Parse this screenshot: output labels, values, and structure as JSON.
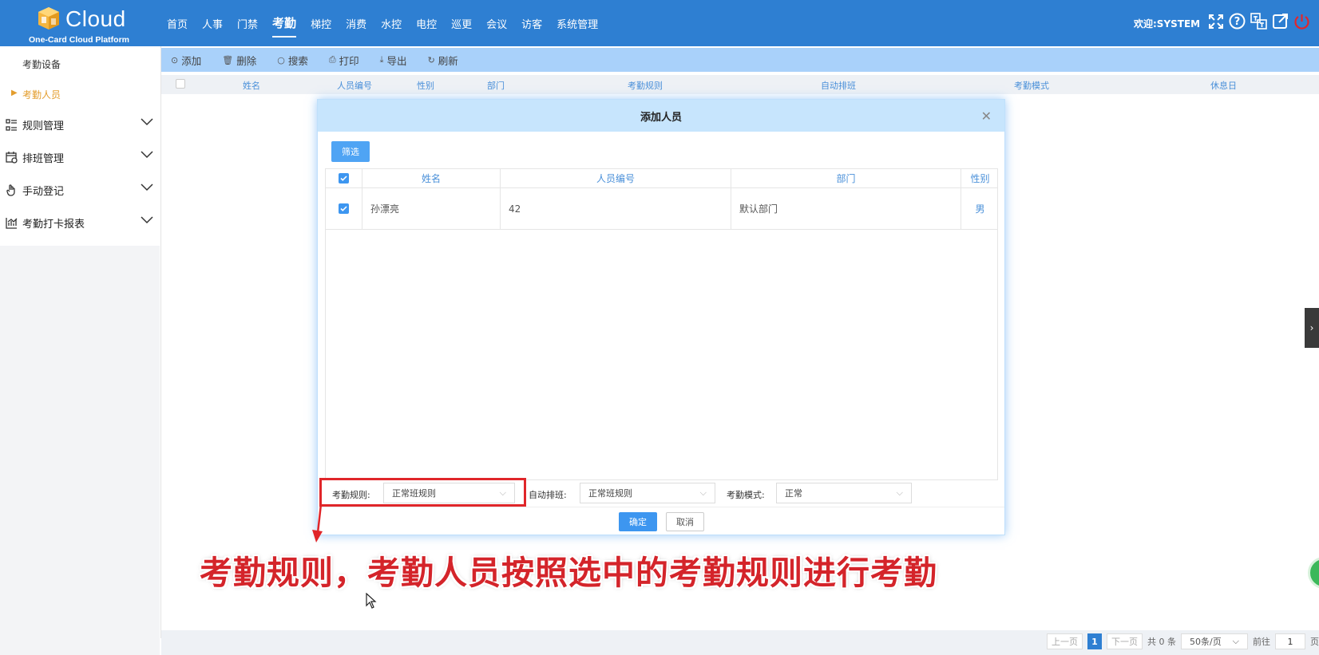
{
  "header": {
    "logo_text": "Cloud",
    "logo_sub": "One-Card Cloud Platform",
    "nav": [
      "首页",
      "人事",
      "门禁",
      "考勤",
      "梯控",
      "消费",
      "水控",
      "电控",
      "巡更",
      "会议",
      "访客",
      "系统管理"
    ],
    "active_nav": "考勤",
    "welcome": "欢迎:SYSTEM",
    "icons": [
      "fullscreen-icon",
      "help-icon",
      "language-icon",
      "external-link-icon",
      "power-icon"
    ]
  },
  "sidebar": {
    "sub_items": [
      {
        "label": "考勤设备"
      },
      {
        "label": "考勤人员",
        "active": true
      }
    ],
    "groups": [
      {
        "label": "规则管理",
        "icon": "list-icon"
      },
      {
        "label": "排班管理",
        "icon": "calendar-icon"
      },
      {
        "label": "手动登记",
        "icon": "hand-icon"
      },
      {
        "label": "考勤打卡报表",
        "icon": "chart-icon"
      }
    ]
  },
  "toolbar": {
    "add": "添加",
    "delete": "删除",
    "search": "搜索",
    "print": "打印",
    "export": "导出",
    "refresh": "刷新"
  },
  "main_table": {
    "columns": [
      "姓名",
      "人员编号",
      "性别",
      "部门",
      "考勤规则",
      "自动排班",
      "考勤模式",
      "休息日"
    ]
  },
  "pager": {
    "prev": "上一页",
    "page": "1",
    "next": "下一页",
    "total": "共 0 条",
    "size": "50条/页",
    "goto": "前往",
    "goto_value": "1",
    "page_unit": "页"
  },
  "modal": {
    "title": "添加人员",
    "filter_button": "筛选",
    "columns": [
      "姓名",
      "人员编号",
      "部门",
      "性别"
    ],
    "rows": [
      {
        "name": "孙漂亮",
        "id": "42",
        "dept": "默认部门",
        "gender": "男",
        "checked": true
      }
    ],
    "form": {
      "rule_label": "考勤规则:",
      "rule_value": "正常班规则",
      "schedule_label": "自动排班:",
      "schedule_value": "正常班规则",
      "mode_label": "考勤模式:",
      "mode_value": "正常"
    },
    "ok": "确定",
    "cancel": "取消"
  },
  "annotation": {
    "caption": "考勤规则，考勤人员按照选中的考勤规则进行考勤",
    "color": "#d4242a"
  },
  "colors": {
    "header": "#2e7fd2",
    "toolbar": "#a9d1fa",
    "accent": "#3d96f0",
    "sidebar_active": "#e39d2d"
  }
}
